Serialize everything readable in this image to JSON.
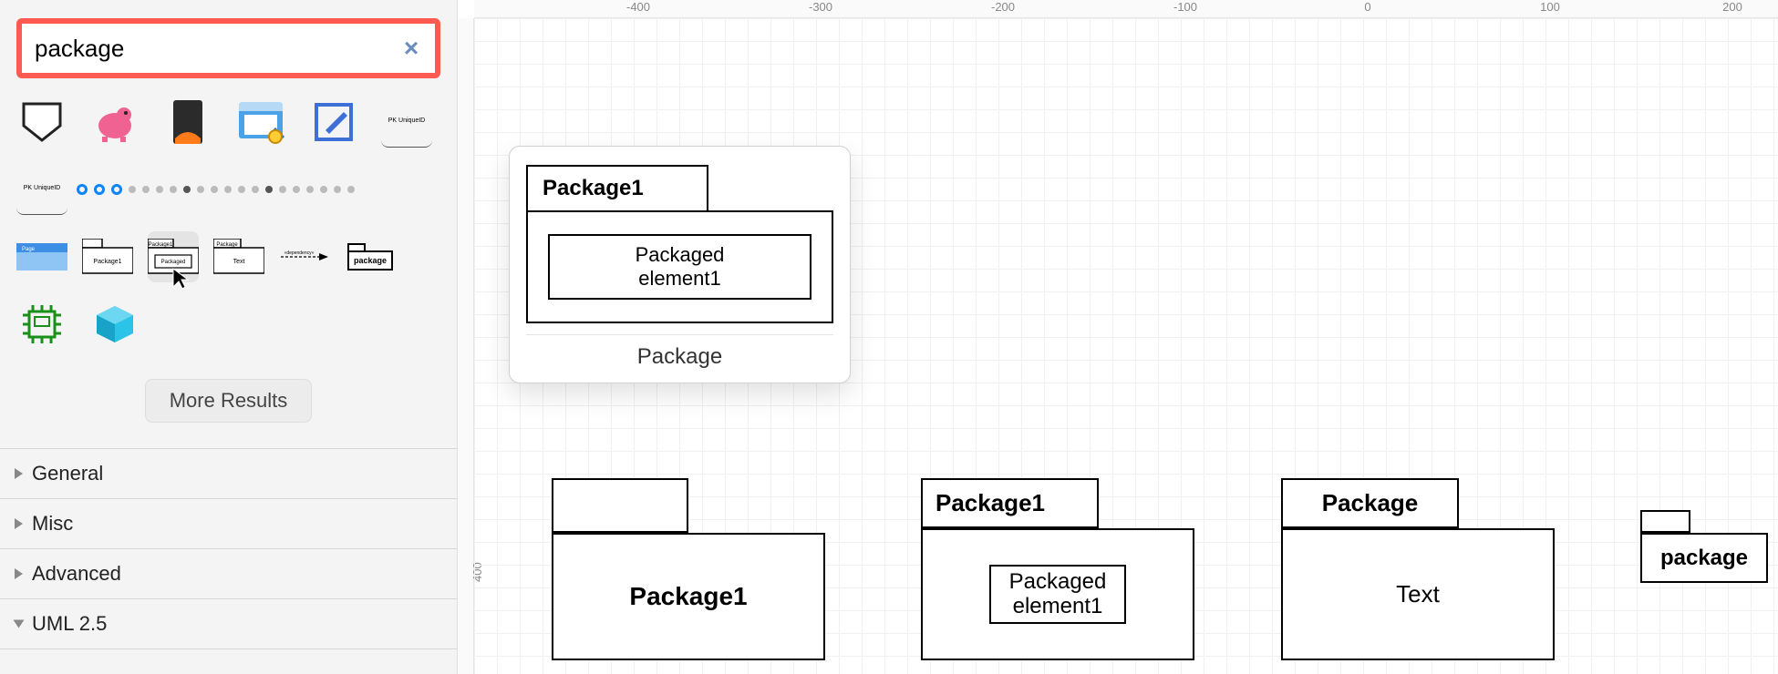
{
  "search": {
    "value": "package",
    "clear_glyph": "×"
  },
  "palette": {
    "tiny_label": "PK  UniqueID",
    "mini_labels": {
      "package1": "Package1",
      "packaged": "Packaged",
      "package": "Package",
      "text": "Text",
      "pkgbold": "package"
    }
  },
  "more_results_label": "More Results",
  "accordion": [
    "General",
    "Misc",
    "Advanced",
    "UML 2.5"
  ],
  "ruler_h": [
    "-400",
    "-300",
    "-200",
    "-100",
    "0",
    "100",
    "200"
  ],
  "ruler_v": [
    "400"
  ],
  "preview": {
    "tab": "Package1",
    "inner_l1": "Packaged",
    "inner_l2": "element1",
    "label": "Package"
  },
  "canvas_nodes": {
    "n1": {
      "body_label": "Package1"
    },
    "n2": {
      "tab": "Package1",
      "inner_l1": "Packaged",
      "inner_l2": "element1"
    },
    "n3": {
      "tab": "Package",
      "body_label": "Text"
    },
    "n4": {
      "body_label": "package"
    }
  }
}
